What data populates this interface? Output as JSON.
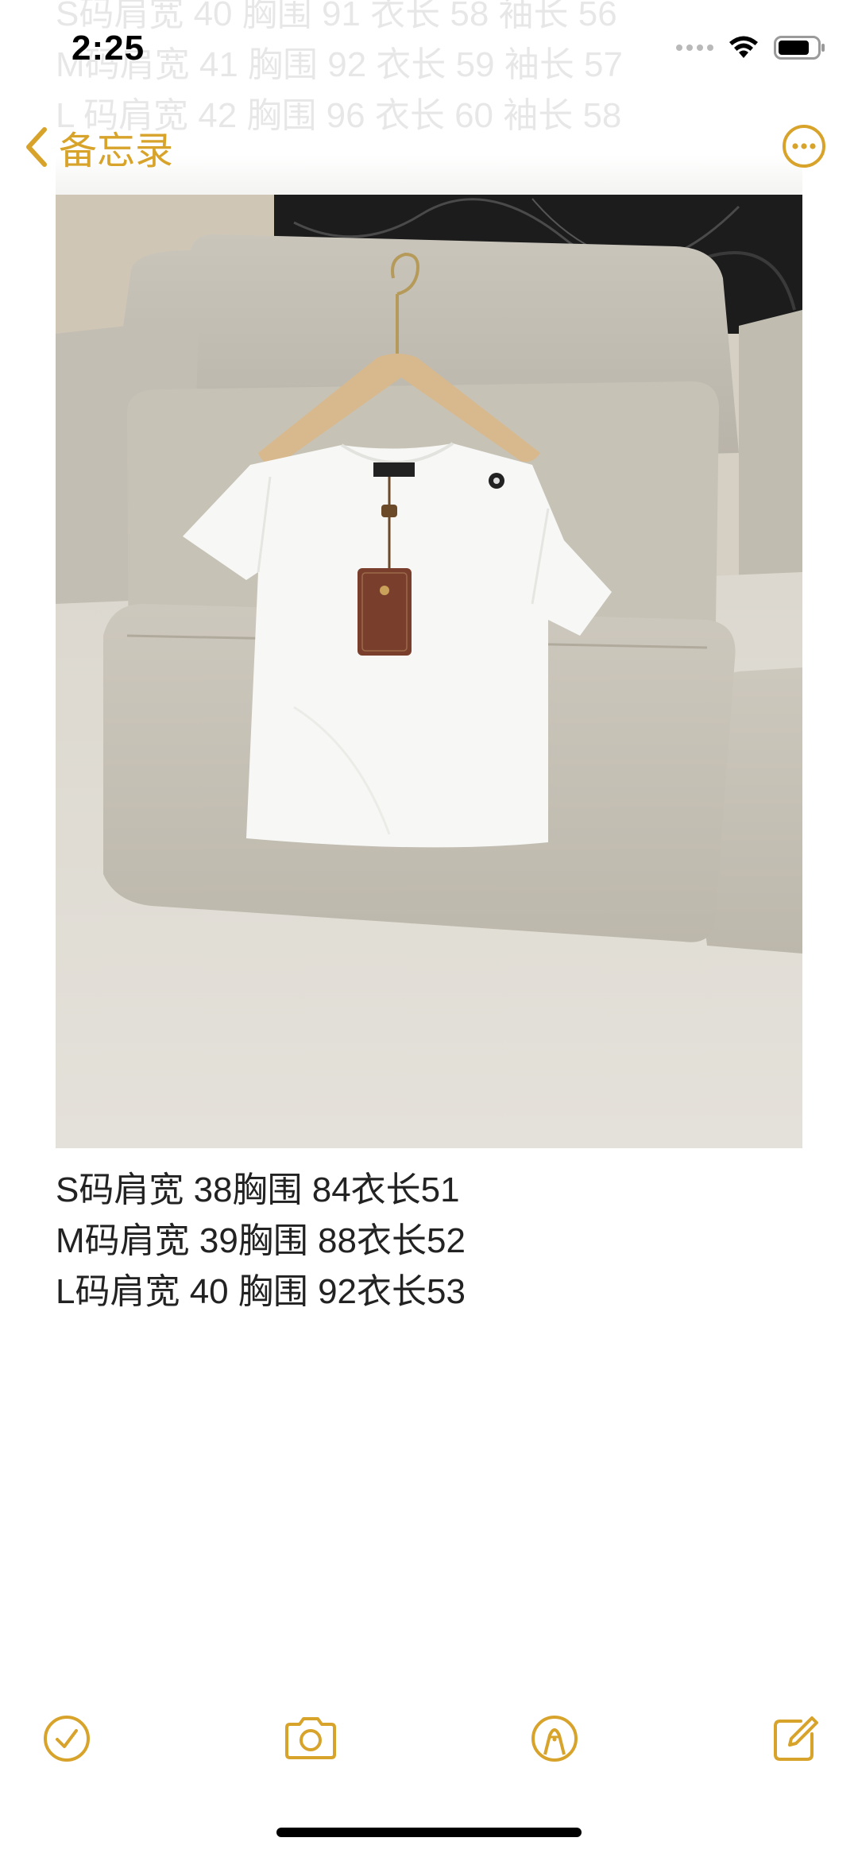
{
  "status_bar": {
    "time": "2:25"
  },
  "ghost_lines": [
    "S码肩宽 40 胸围 91 衣长 58 袖长 56",
    "M码肩宽 41 胸围 92 衣长 59 袖长 57",
    "L 码肩宽 42 胸围 96 衣长 60 袖长 58"
  ],
  "nav": {
    "back_label": "备忘录",
    "more_icon": "ellipsis-circle-icon"
  },
  "note": {
    "image_description_icon": "photo-attachment",
    "lines": [
      "S码肩宽 38胸围 84衣长51",
      "M码肩宽 39胸围 88衣长52",
      "L码肩宽 40 胸围 92衣长53"
    ]
  },
  "toolbar": {
    "checklist_icon": "checkmark-circle-icon",
    "camera_icon": "camera-icon",
    "markup_icon": "pen-tip-circle-icon",
    "compose_icon": "compose-icon"
  },
  "colors": {
    "accent": "#d8a32a",
    "text": "#222222",
    "background": "#ffffff"
  }
}
